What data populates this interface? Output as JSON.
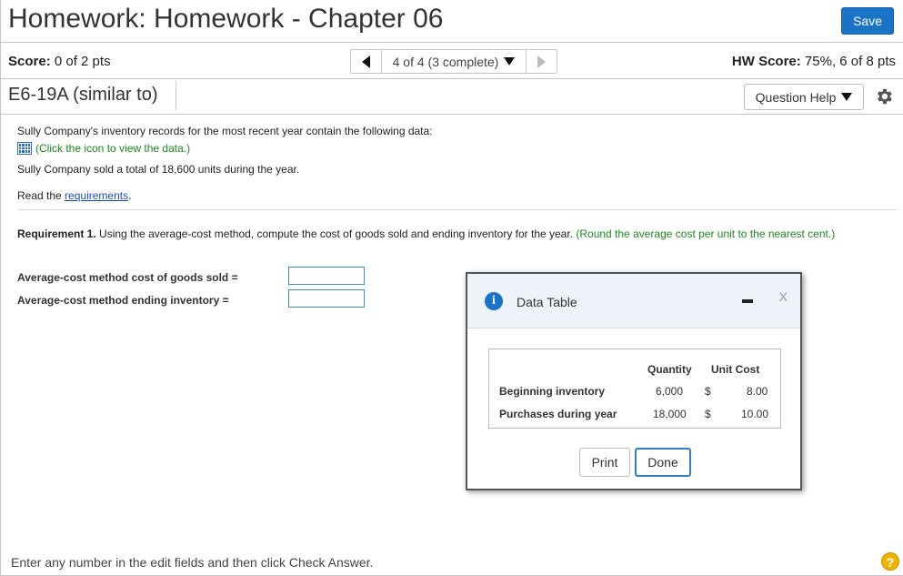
{
  "header": {
    "title": "Homework: Homework - Chapter 06",
    "save_label": "Save"
  },
  "scorebar": {
    "score_label": "Score:",
    "score_value": "0 of 2 pts",
    "pager_text": "4 of 4 (3 complete)",
    "hw_label": "HW Score:",
    "hw_value": "75%, 6 of 8 pts"
  },
  "question": {
    "name": "E6-19A (similar to)",
    "help_label": "Question Help"
  },
  "content": {
    "intro": "Sully Company's inventory records for the most recent year contain the following data:",
    "data_link": "(Click the icon to view the data.)",
    "units_sold": "Sully Company sold a total of 18,600 units during the year.",
    "read_the": "Read the ",
    "requirements_link": "requirements",
    "period": ".",
    "req1_label": "Requirement 1.",
    "req1_text": " Using the average-cost method, compute the cost of goods sold and ending inventory for the year. ",
    "req1_hint": "(Round the average cost per unit to the nearest cent.)",
    "answer1_label": "Average-cost method cost of goods sold =",
    "answer2_label": "Average-cost method ending inventory ="
  },
  "modal": {
    "title": "Data Table",
    "close": "X",
    "info_glyph": "i",
    "col_quantity": "Quantity",
    "col_unit_cost": "Unit Cost",
    "rows": [
      {
        "label": "Beginning inventory",
        "quantity": "6,000",
        "dollar": "$",
        "cost": "8.00"
      },
      {
        "label": "Purchases during year",
        "quantity": "18,000",
        "dollar": "$",
        "cost": "10.00"
      }
    ],
    "print_label": "Print",
    "done_label": "Done"
  },
  "footer": {
    "text": "Enter any number in the edit fields and then click Check Answer.",
    "help_glyph": "?"
  },
  "colors": {
    "accent": "#1a73c6",
    "hint_green": "#1a8a1a",
    "help_yellow": "#f0b400"
  }
}
